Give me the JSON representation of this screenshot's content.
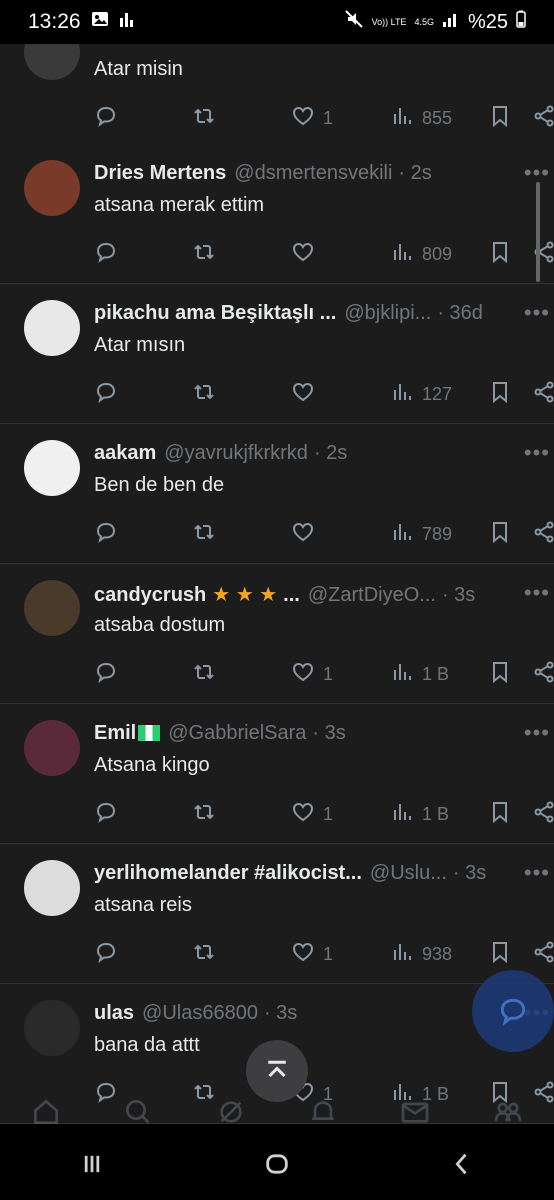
{
  "status_bar": {
    "time": "13:26",
    "network": "4.5G",
    "volte": "Vo)) LTE",
    "battery": "%25"
  },
  "tweets": [
    {
      "name": "",
      "handle": "",
      "time": "",
      "text": "Atar misin",
      "likes": "1",
      "views": "855"
    },
    {
      "name": "Dries Mertens",
      "handle": "@dsmertensvekili",
      "time": "· 2s",
      "text": "atsana merak ettim",
      "likes": "",
      "views": "809"
    },
    {
      "name": "pikachu ama Beşiktaşlı ...",
      "handle": "@bjklipi...",
      "time": "· 36d",
      "text": "Atar mısın",
      "likes": "",
      "views": "127"
    },
    {
      "name": "aakam",
      "handle": "@yavrukjfkrkrkd",
      "time": "· 2s",
      "text": "Ben de ben de",
      "likes": "",
      "views": "789"
    },
    {
      "name": "candycrush",
      "stars": "★ ★ ★",
      "ellipsis": "...",
      "handle": "@ZartDiyeO...",
      "time": "· 3s",
      "text": "atsaba dostum",
      "likes": "1",
      "views": "1 B"
    },
    {
      "name": "Emil",
      "flag_color": "#2ecc71",
      "handle": "@GabbrielSara",
      "time": "· 3s",
      "text": "Atsana kingo",
      "likes": "1",
      "views": "1 B"
    },
    {
      "name": "yerlihomelander #alikocist...",
      "handle": "@Uslu...",
      "time": "· 3s",
      "text": "atsana reis",
      "likes": "1",
      "views": "938"
    },
    {
      "name": "ulas",
      "handle": "@Ulas66800",
      "time": "· 3s",
      "text": "bana da attt",
      "likes": "1",
      "views": "1 B"
    }
  ],
  "colors": {
    "background": "#1c1c1c",
    "muted": "#71767b",
    "fab": "#1d3a78",
    "star": "#f4a621"
  }
}
